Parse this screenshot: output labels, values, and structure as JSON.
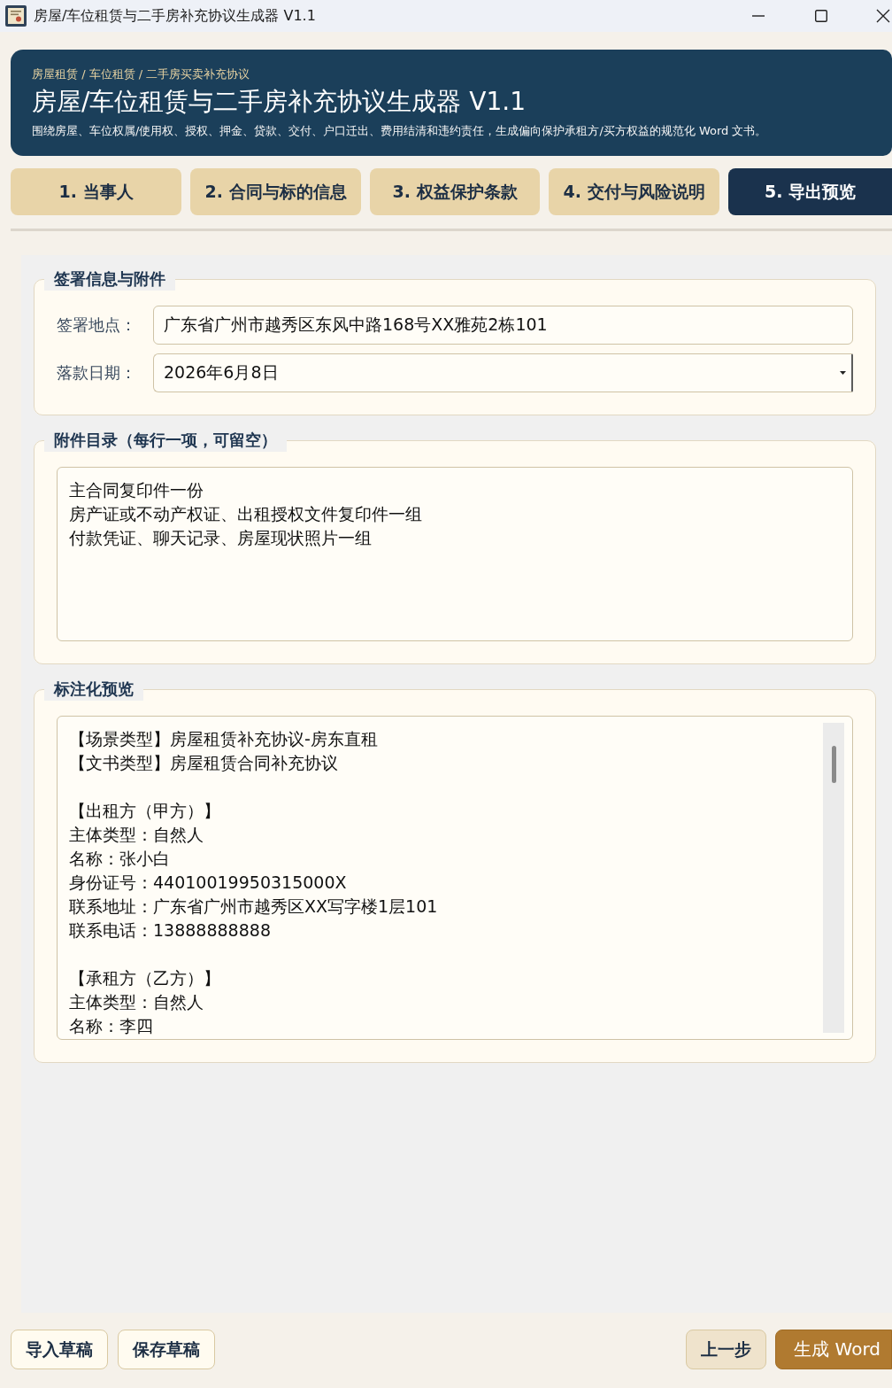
{
  "window": {
    "title": "房屋/车位租赁与二手房补充协议生成器 V1.1"
  },
  "header": {
    "breadcrumb": "房屋租赁 / 车位租赁 / 二手房买卖补充协议",
    "title": "房屋/车位租赁与二手房补充协议生成器 V1.1",
    "subtitle": "围绕房屋、车位权属/使用权、授权、押金、贷款、交付、户口迁出、费用结清和违约责任，生成偏向保护承租方/买方权益的规范化 Word 文书。"
  },
  "tabs": [
    {
      "label": "1. 当事人",
      "selected": false
    },
    {
      "label": "2. 合同与标的信息",
      "selected": false
    },
    {
      "label": "3. 权益保护条款",
      "selected": false
    },
    {
      "label": "4. 交付与风险说明",
      "selected": false
    },
    {
      "label": "5. 导出预览",
      "selected": true
    }
  ],
  "signing": {
    "legend": "签署信息与附件",
    "fields": [
      {
        "kind": "text",
        "label": "签署地点：",
        "value": "广东省广州市越秀区东风中路168号XX雅苑2栋101"
      },
      {
        "kind": "dropdown",
        "label": "落款日期：",
        "value": "2026年6月8日"
      }
    ]
  },
  "attachments": {
    "legend": "附件目录（每行一项，可留空）",
    "lines": [
      "主合同复印件一份",
      "房产证或不动产权证、出租授权文件复印件一组",
      "付款凭证、聊天记录、房屋现状照片一组"
    ]
  },
  "preview": {
    "legend": "标注化预览",
    "blocks": [
      [
        "【场景类型】房屋租赁补充协议-房东直租",
        "【文书类型】房屋租赁合同补充协议"
      ],
      [
        "【出租方（甲方）】",
        "主体类型：自然人",
        "名称：张小白",
        "身份证号：44010019950315000X",
        "联系地址：广东省广州市越秀区XX写字楼1层101",
        "联系电话：13888888888"
      ],
      [
        "【承租方（乙方）】",
        "主体类型：自然人",
        "名称：李四"
      ]
    ]
  },
  "footer": {
    "left": [
      {
        "label": "导入草稿",
        "kind": "outline"
      },
      {
        "label": "保存草稿",
        "kind": "outline"
      }
    ],
    "right": [
      {
        "label": "上一步",
        "kind": "secondary"
      },
      {
        "label": "生成 Word",
        "kind": "primary"
      }
    ]
  }
}
